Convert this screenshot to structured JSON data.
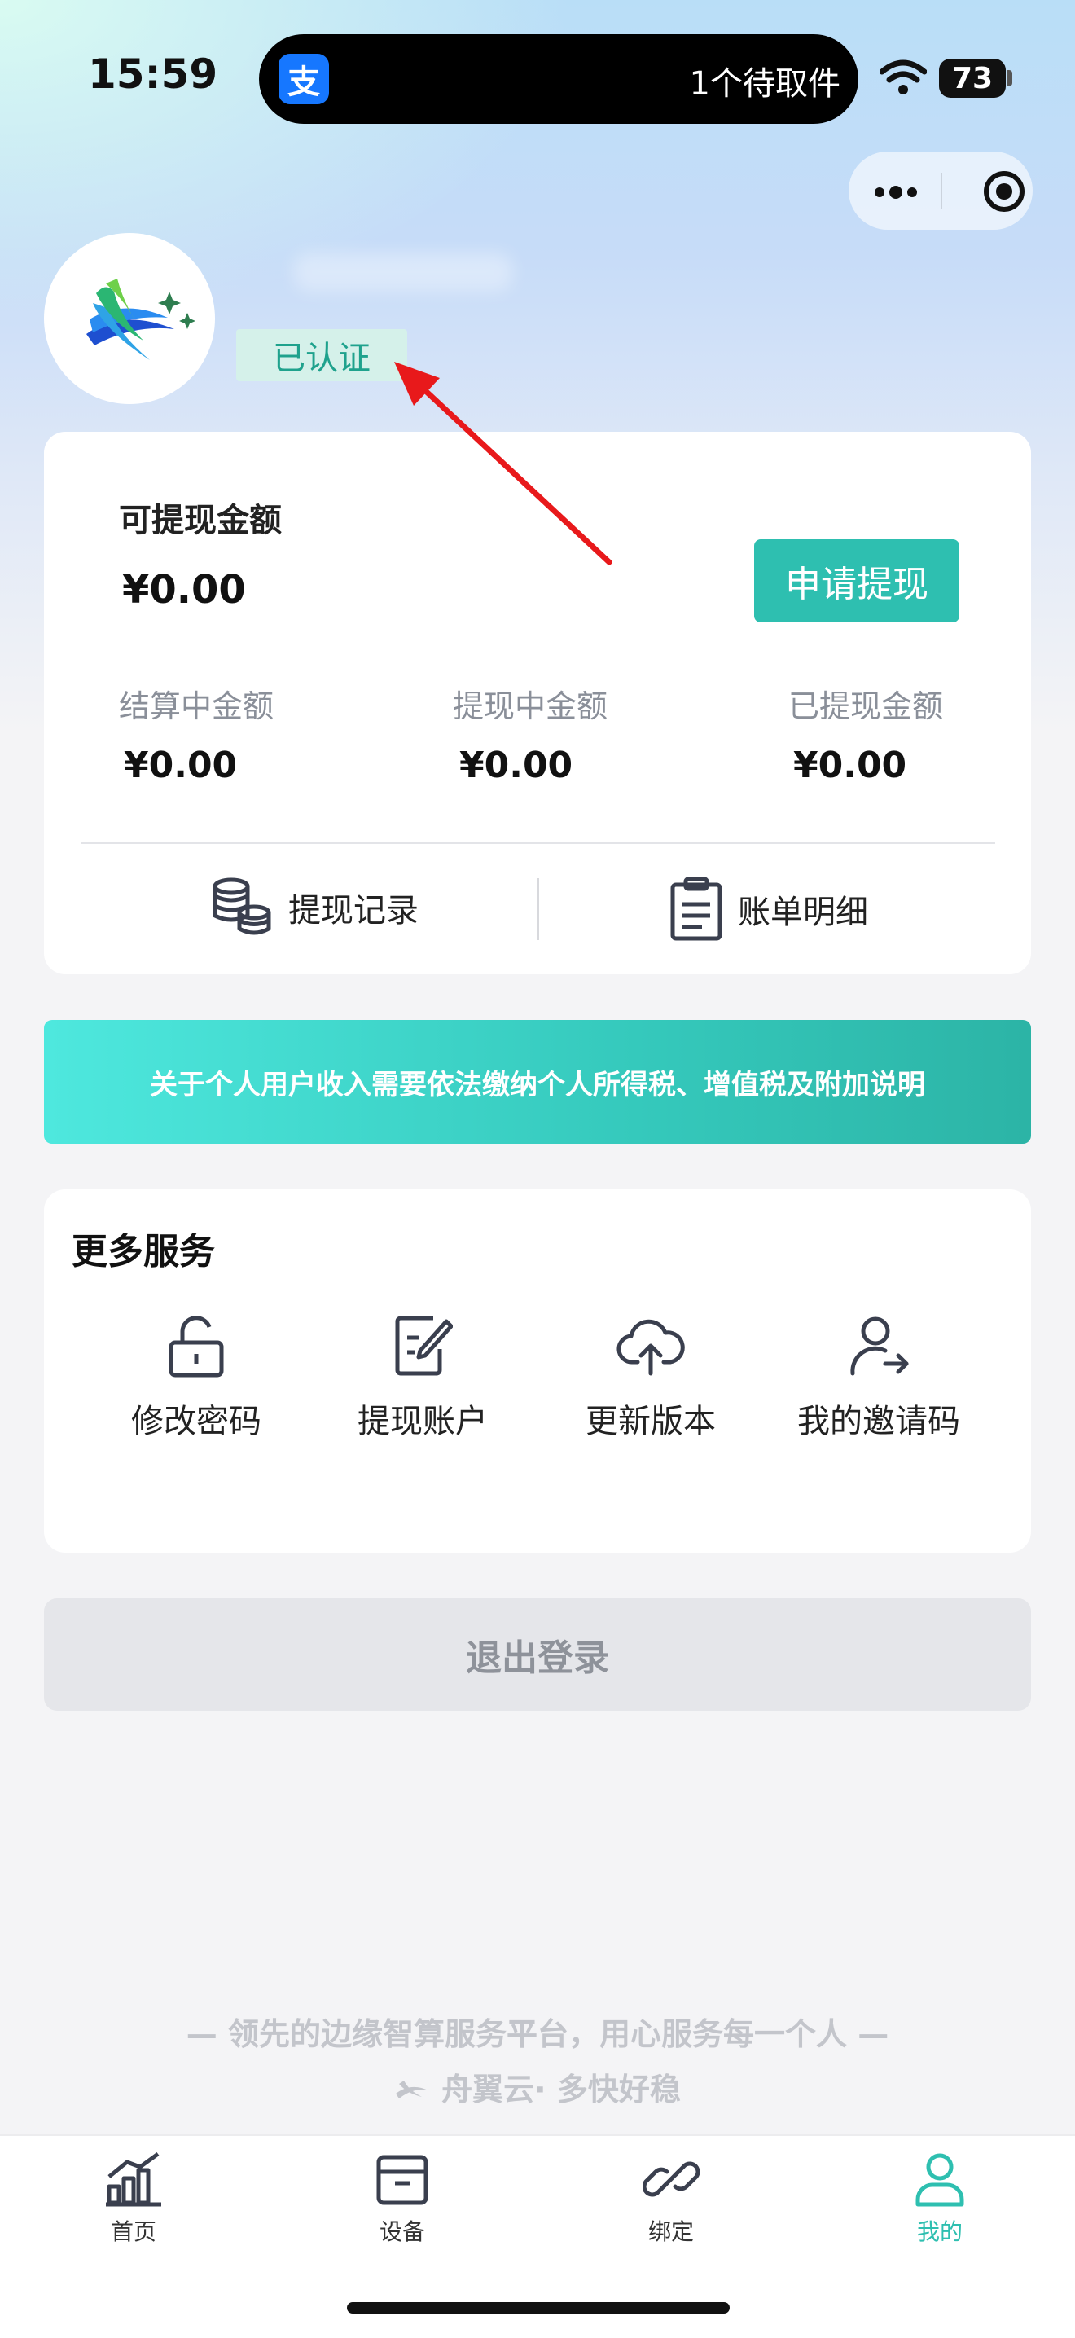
{
  "status_bar": {
    "time": "15:59",
    "alipay_glyph": "支",
    "pickup_text": "1个待取件",
    "battery": "73"
  },
  "profile": {
    "verified_badge": "已认证"
  },
  "wallet": {
    "available_label": "可提现金额",
    "available_amount": "¥0.00",
    "withdraw_button": "申请提现",
    "stats": [
      {
        "label": "结算中金额",
        "amount": "¥0.00"
      },
      {
        "label": "提现中金额",
        "amount": "¥0.00"
      },
      {
        "label": "已提现金额",
        "amount": "¥0.00"
      }
    ],
    "links": {
      "records": "提现记录",
      "bills": "账单明细"
    }
  },
  "notice": {
    "text": "关于个人用户收入需要依法缴纳个人所得税、增值税及附加说明"
  },
  "services": {
    "title": "更多服务",
    "items": [
      {
        "label": "修改密码",
        "icon": "unlock-icon"
      },
      {
        "label": "提现账户",
        "icon": "edit-document-icon"
      },
      {
        "label": "更新版本",
        "icon": "cloud-upload-icon"
      },
      {
        "label": "我的邀请码",
        "icon": "user-share-icon"
      }
    ]
  },
  "logout_label": "退出登录",
  "footer": {
    "slogan": "— 领先的边缘智算服务平台，用心服务每一个人 —",
    "brand": "舟翼云· 多快好稳"
  },
  "tabs": [
    {
      "label": "首页",
      "icon": "chart-icon",
      "active": false
    },
    {
      "label": "设备",
      "icon": "box-icon",
      "active": false
    },
    {
      "label": "绑定",
      "icon": "link-icon",
      "active": false
    },
    {
      "label": "我的",
      "icon": "user-icon",
      "active": true
    }
  ],
  "colors": {
    "accent": "#2ebfb0",
    "annotation_arrow": "#e8191b",
    "verified_bg": "#d5f1ea"
  }
}
